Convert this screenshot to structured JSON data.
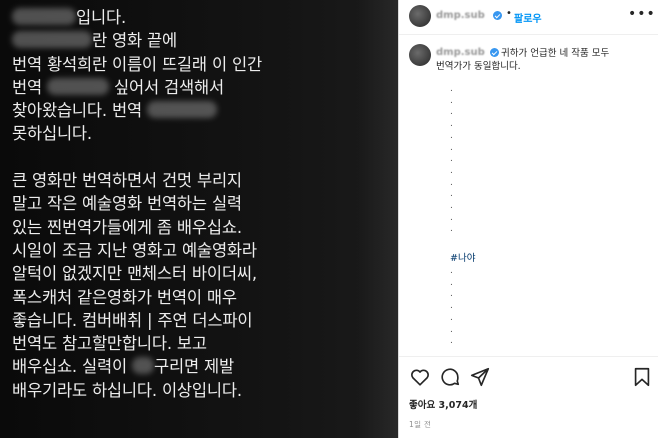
{
  "message": {
    "lines": [
      {
        "pre": "",
        "blur": 64,
        "post": "입니다. "
      },
      {
        "pre": "",
        "blur": 80,
        "post": "란 영화 끝에"
      },
      {
        "pre": "번역 황석희란 이름이 뜨길래 이 인간",
        "blur": 0,
        "post": ""
      },
      {
        "pre": "번역 ",
        "blur": 62,
        "post": " 싶어서 검색해서"
      },
      {
        "pre": "찾아왔습니다. 번역 ",
        "blur": 70,
        "post": ""
      },
      {
        "pre": "못하십니다.",
        "blur": 0,
        "post": ""
      },
      {
        "pre": "",
        "blur": 0,
        "post": "",
        "gap": true
      },
      {
        "pre": "큰 영화만 번역하면서 건멋 부리지",
        "blur": 0,
        "post": ""
      },
      {
        "pre": "말고 작은 예술영화 번역하는 실력",
        "blur": 0,
        "post": ""
      },
      {
        "pre": "있는 찐번역가들에게 좀 배우십쇼.",
        "blur": 0,
        "post": ""
      },
      {
        "pre": "시일이 조금 지난 영화고 예술영화라",
        "blur": 0,
        "post": ""
      },
      {
        "pre": "알턱이 없겠지만 맨체스터 바이더씨,",
        "blur": 0,
        "post": ""
      },
      {
        "pre": "폭스캐처 같은영화가 번역이 매우",
        "blur": 0,
        "post": ""
      },
      {
        "pre": "좋습니다. 컴버배취 | 주연 더스파이",
        "blur": 0,
        "post": ""
      },
      {
        "pre": "번역도 참고할만합니다. 보고",
        "blur": 0,
        "post": ""
      },
      {
        "pre": "배우십쇼. 실력이 ",
        "blur": 22,
        "post": "구리면 제발"
      },
      {
        "pre": "배우기라도 하십니다. 이상입니다.",
        "blur": 0,
        "post": ""
      }
    ]
  },
  "post": {
    "username": "dmp.sub",
    "follow_label": "팔로우",
    "separator": "•",
    "more_label": "•••",
    "caption_line1": "귀하가 언급한 네 작품 모두",
    "caption_line2": "번역가가 동일합니다.",
    "dots_top": [
      ".",
      ".",
      ".",
      ".",
      ".",
      ".",
      ".",
      ".",
      ".",
      ".",
      ".",
      ".",
      "."
    ],
    "hashtag": "#나야",
    "dots_bottom": [
      ".",
      ".",
      ".",
      ".",
      ".",
      ".",
      "."
    ],
    "likes_text": "좋아요 3,074개",
    "time_text": "1일 전",
    "icons": [
      "heart-icon",
      "comment-icon",
      "share-icon",
      "bookmark-icon"
    ]
  },
  "colors": {
    "accent": "#0095f6",
    "verified": "#3897f0",
    "hashtag": "#00376b",
    "dark_bg": "#0a0a0a"
  }
}
